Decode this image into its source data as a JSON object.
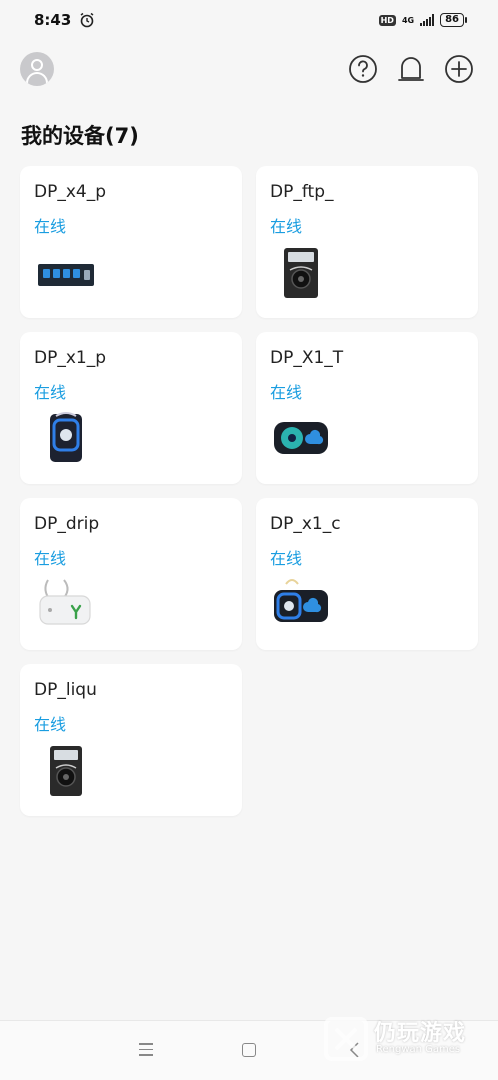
{
  "status_bar": {
    "time": "8:43",
    "hd": "HD",
    "network": "4G",
    "battery": "86"
  },
  "page": {
    "title": "我的设备(7)"
  },
  "devices": [
    {
      "name": "DP_x4_p",
      "status": "在线",
      "image": "x4-pump-image"
    },
    {
      "name": "DP_ftp_",
      "status": "在线",
      "image": "ftp-pump-image"
    },
    {
      "name": "DP_x1_p",
      "status": "在线",
      "image": "x1p-pump-image"
    },
    {
      "name": "DP_X1_T",
      "status": "在线",
      "image": "x1t-pump-image"
    },
    {
      "name": "DP_drip",
      "status": "在线",
      "image": "drip-pump-image"
    },
    {
      "name": "DP_x1_c",
      "status": "在线",
      "image": "x1c-pump-image"
    },
    {
      "name": "DP_liqu",
      "status": "在线",
      "image": "liqu-pump-image"
    }
  ],
  "watermark": {
    "title": "仍玩游戏",
    "subtitle": "Rengwan Games"
  },
  "colors": {
    "online": "#1a9de0",
    "background": "#f6f6f6",
    "card": "#ffffff"
  }
}
